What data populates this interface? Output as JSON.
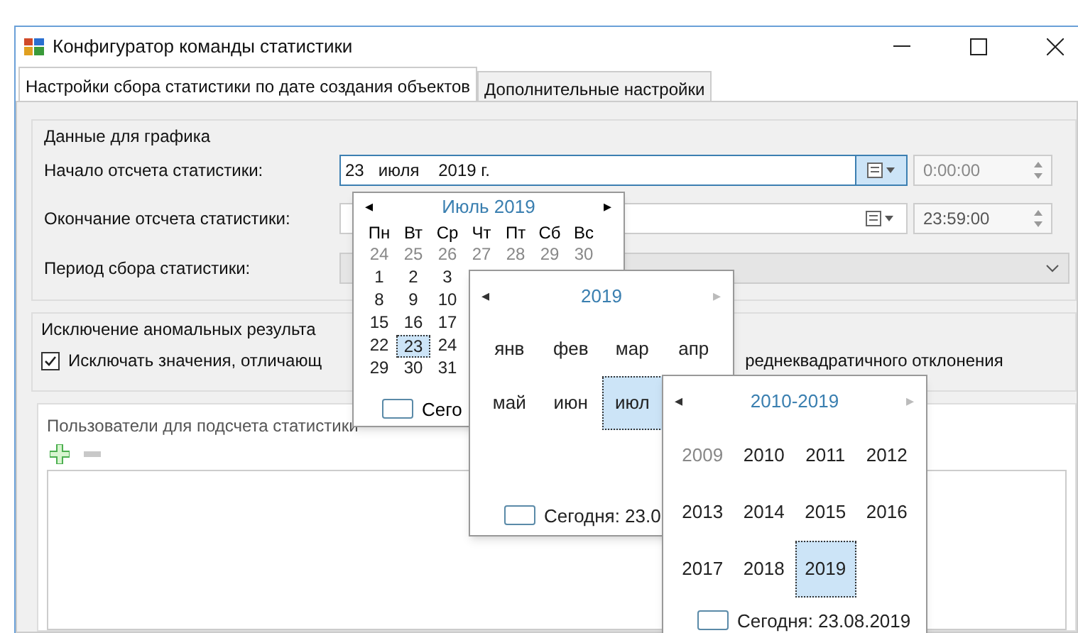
{
  "window": {
    "title": "Конфигуратор команды статистики"
  },
  "tabs": [
    {
      "label": "Настройки сбора статистики по дате создания объектов",
      "selected": true
    },
    {
      "label": "Дополнительные настройки",
      "selected": false
    }
  ],
  "chart_group": {
    "title": "Данные для графика",
    "start": {
      "label": "Начало отсчета статистики:",
      "value": "23   июля    2019 г.",
      "time": "0:00:00"
    },
    "end": {
      "label": "Окончание отсчета статистики:",
      "time": "23:59:00"
    },
    "period": {
      "label": "Период сбора статистики:"
    }
  },
  "exclusion_group": {
    "title": "Исключение аномальных результа",
    "checkbox": {
      "checked": true,
      "label_start": "Исключать значения, отличающ",
      "label_end": "реднеквадратичного отклонения"
    }
  },
  "users_group": {
    "title": "Пользователи для подсчета статистики"
  },
  "day_calendar": {
    "title": "Июль 2019",
    "prev": "◂",
    "next": "▸",
    "weekdays": [
      "Пн",
      "Вт",
      "Ср",
      "Чт",
      "Пт",
      "Сб",
      "Вс"
    ],
    "weeks": [
      [
        {
          "day": "24",
          "other_month": true,
          "selected": false
        },
        {
          "day": "25",
          "other_month": true,
          "selected": false
        },
        {
          "day": "26",
          "other_month": true,
          "selected": false
        },
        {
          "day": "27",
          "other_month": true,
          "selected": false
        },
        {
          "day": "28",
          "other_month": true,
          "selected": false
        },
        {
          "day": "29",
          "other_month": true,
          "selected": false
        },
        {
          "day": "30",
          "other_month": true,
          "selected": false
        }
      ],
      [
        {
          "day": "1",
          "other_month": false,
          "selected": false
        },
        {
          "day": "2",
          "other_month": false,
          "selected": false
        },
        {
          "day": "3",
          "other_month": false,
          "selected": false
        }
      ],
      [
        {
          "day": "8",
          "other_month": false,
          "selected": false
        },
        {
          "day": "9",
          "other_month": false,
          "selected": false
        },
        {
          "day": "10",
          "other_month": false,
          "selected": false
        }
      ],
      [
        {
          "day": "15",
          "other_month": false,
          "selected": false
        },
        {
          "day": "16",
          "other_month": false,
          "selected": false
        },
        {
          "day": "17",
          "other_month": false,
          "selected": false
        }
      ],
      [
        {
          "day": "22",
          "other_month": false,
          "selected": false
        },
        {
          "day": "23",
          "other_month": false,
          "selected": true
        },
        {
          "day": "24",
          "other_month": false,
          "selected": false
        }
      ],
      [
        {
          "day": "29",
          "other_month": false,
          "selected": false
        },
        {
          "day": "30",
          "other_month": false,
          "selected": false
        },
        {
          "day": "31",
          "other_month": false,
          "selected": false
        }
      ]
    ],
    "today": "Сего"
  },
  "month_calendar": {
    "title": "2019",
    "prev": "◂",
    "next": "▸",
    "items": [
      {
        "label": "янв",
        "dim": false,
        "selected": false
      },
      {
        "label": "фев",
        "dim": false,
        "selected": false
      },
      {
        "label": "мар",
        "dim": false,
        "selected": false
      },
      {
        "label": "апр",
        "dim": false,
        "selected": false
      },
      {
        "label": "май",
        "dim": false,
        "selected": false
      },
      {
        "label": "июн",
        "dim": false,
        "selected": false
      },
      {
        "label": "июл",
        "dim": false,
        "selected": true
      }
    ],
    "today": "Сегодня: 23.0"
  },
  "year_calendar": {
    "title": "2010-2019",
    "prev": "◂",
    "next": "▸",
    "items": [
      {
        "label": "2009",
        "dim": true,
        "selected": false
      },
      {
        "label": "2010",
        "dim": false,
        "selected": false
      },
      {
        "label": "2011",
        "dim": false,
        "selected": false
      },
      {
        "label": "2012",
        "dim": false,
        "selected": false
      },
      {
        "label": "2013",
        "dim": false,
        "selected": false
      },
      {
        "label": "2014",
        "dim": false,
        "selected": false
      },
      {
        "label": "2015",
        "dim": false,
        "selected": false
      },
      {
        "label": "2016",
        "dim": false,
        "selected": false
      },
      {
        "label": "2017",
        "dim": false,
        "selected": false
      },
      {
        "label": "2018",
        "dim": false,
        "selected": false
      },
      {
        "label": "2019",
        "dim": false,
        "selected": true
      }
    ],
    "today": "Сегодня: 23.08.2019"
  }
}
